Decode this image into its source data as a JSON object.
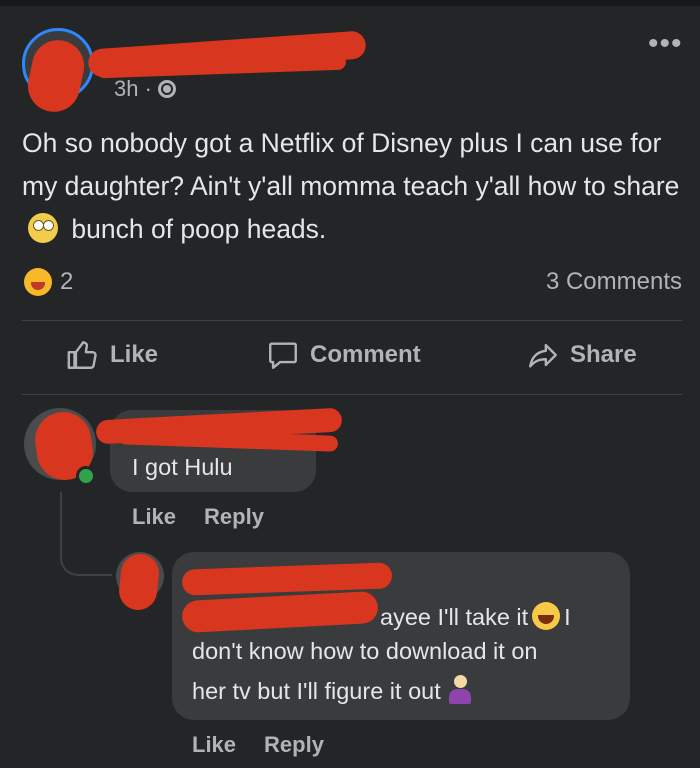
{
  "post": {
    "time": "3h ·",
    "text_part1": "Oh so nobody got a Netflix of Disney plus I can use for my daughter? Ain't y'all momma teach y'all how to share",
    "text_part2": "bunch of poop heads.",
    "emoji_inline": "face-with-rolling-eyes-icon",
    "reaction_count": "2",
    "comments_count": "3 Comments"
  },
  "actions": {
    "like": "Like",
    "comment": "Comment",
    "share": "Share"
  },
  "comments": [
    {
      "text": "I got Hulu",
      "like": "Like",
      "reply": "Reply"
    },
    {
      "text_part1": "ayee I'll take it",
      "text_part2": "I",
      "text_line2": "don't know how to download it on",
      "text_line3": "her tv but I'll figure it out",
      "like": "Like",
      "reply": "Reply"
    }
  ],
  "colors": {
    "background": "#242526",
    "bubble": "#3a3b3c",
    "redaction": "#d9361f",
    "accent_blue": "#2d88ff",
    "online": "#31a24c"
  }
}
